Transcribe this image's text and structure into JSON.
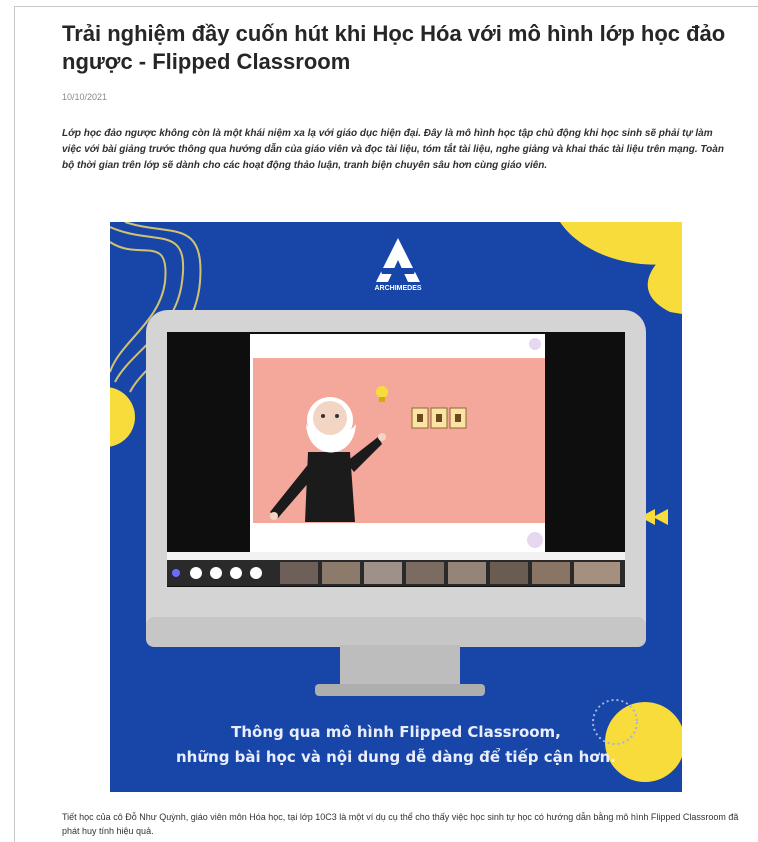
{
  "article": {
    "title": "Trải nghiệm đầy cuốn hút khi Học Hóa với mô hình lớp học đảo ngược - Flipped Classroom",
    "date": "10/10/2021",
    "lead": "Lớp học đảo ngược không còn là một khái niệm xa lạ với giáo dục hiện đại. Đây là mô hình học tập chủ động khi học sinh sẽ phải tự làm việc với bài giảng trước thông qua hướng dẫn của giáo viên và đọc tài liệu, tóm tắt tài liệu, nghe giảng và khai thác tài liệu trên mạng. Toàn bộ thời gian trên lớp sẽ dành cho các hoạt động thảo luận, tranh biện chuyên sâu hơn cùng giáo viên.",
    "body": "Tiết học của cô Đỗ Như Quỳnh, giáo viên môn Hóa học, tại lớp 10C3 là một ví dụ cụ thể cho thấy việc học sinh tự học có hướng dẫn bằng mô hình Flipped Classroom đã phát huy tính hiệu quả."
  },
  "hero": {
    "brand": "ARCHIMEDES",
    "caption_line1": "Thông qua mô hình Flipped Classroom,",
    "caption_line2": "những bài học và nội dung dễ dàng để tiếp cận hơn."
  },
  "colors": {
    "blue": "#1845a8",
    "yellow": "#f8dc3b",
    "salmon": "#f4a89c"
  }
}
